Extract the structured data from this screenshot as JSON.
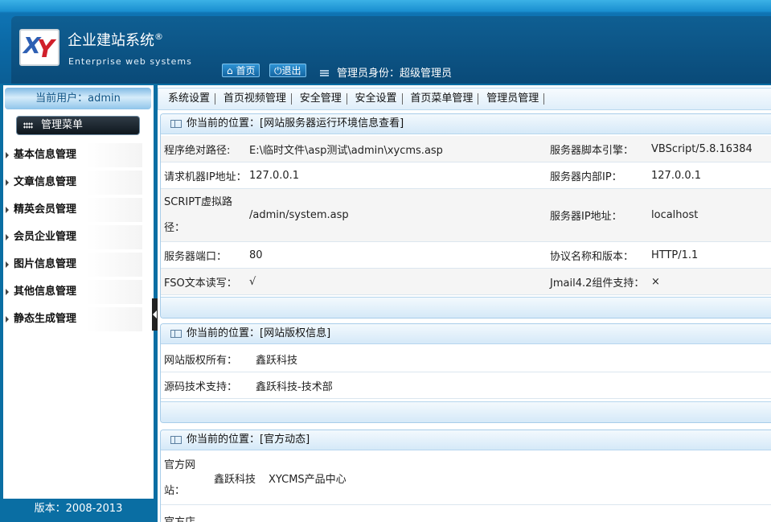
{
  "header": {
    "title": "企业建站系统",
    "title_mark": "®",
    "subtitle": "Enterprise web systems",
    "logo_text_x": "X",
    "logo_text_y": "Y",
    "home_button": "首页",
    "logout_button": "退出",
    "admin_identity": "管理员身份：超级管理员"
  },
  "sidebar": {
    "current_user": "当前用户：admin",
    "menu_title": "管理菜单",
    "items": [
      {
        "label": "基本信息管理"
      },
      {
        "label": "文章信息管理"
      },
      {
        "label": "精英会员管理"
      },
      {
        "label": "会员企业管理"
      },
      {
        "label": "图片信息管理"
      },
      {
        "label": "其他信息管理"
      },
      {
        "label": "静态生成管理"
      }
    ],
    "version": "版本：2008-2013"
  },
  "topnav": {
    "tabs": [
      {
        "label": "系统设置"
      },
      {
        "label": "首页视频管理"
      },
      {
        "label": "安全管理"
      },
      {
        "label": "安全设置"
      },
      {
        "label": "首页菜单管理"
      },
      {
        "label": "管理员管理"
      }
    ]
  },
  "panels": {
    "server": {
      "title": "你当前的位置：[网站服务器运行环境信息查看]",
      "rows": [
        {
          "l1": "程序绝对路径:",
          "v1": "E:\\临时文件\\asp测试\\admin\\xycms.asp",
          "l2": "服务器脚本引擎：",
          "v2": "VBScript/5.8.16384"
        },
        {
          "l1": "请求机器IP地址：",
          "v1": "127.0.0.1",
          "l2": "服务器内部IP：",
          "v2": "127.0.0.1"
        },
        {
          "l1": "SCRIPT虚拟路径：",
          "v1": "/admin/system.asp",
          "l2": "服务器IP地址：",
          "v2": "localhost"
        },
        {
          "l1": "服务器端口：",
          "v1": "80",
          "l2": "协议名称和版本：",
          "v2": "HTTP/1.1"
        },
        {
          "l1": "FSO文本读写：",
          "v1": "√",
          "l2": "Jmail4.2组件支持：",
          "v2": "×"
        }
      ]
    },
    "copyright": {
      "title": "你当前的位置：[网站版权信息]",
      "rows": [
        {
          "l1": "网站版权所有：",
          "v1": "鑫跃科技"
        },
        {
          "l1": "源码技术支持：",
          "v1": "鑫跃科技-技术部"
        }
      ]
    },
    "news": {
      "title": "你当前的位置：[官方动态]",
      "rows": [
        {
          "l1": "官方网站：",
          "v1": "鑫跃科技",
          "v1b": "XYCMS产品中心"
        },
        {
          "l1": "官方店"
        }
      ]
    }
  }
}
